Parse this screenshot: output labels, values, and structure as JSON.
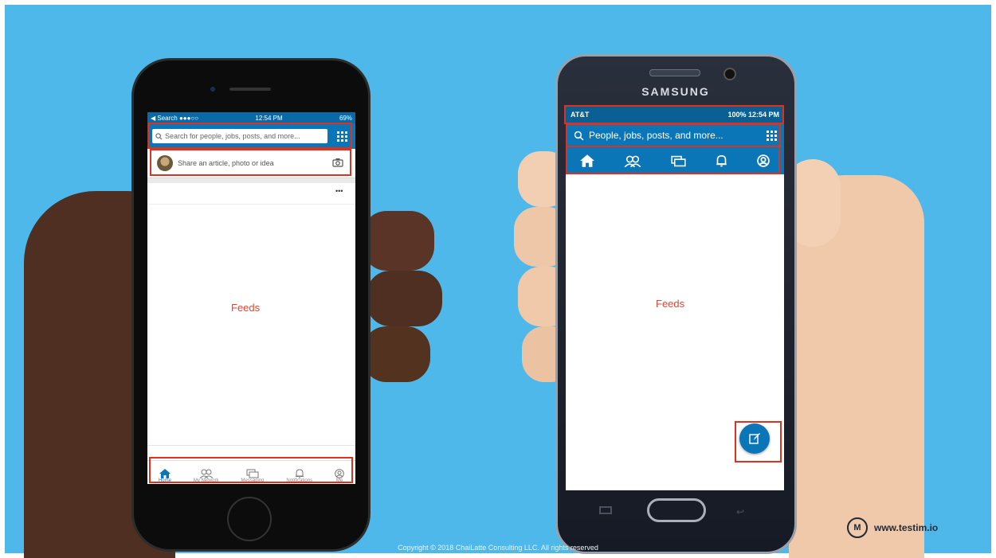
{
  "iphone": {
    "status": {
      "carrier": "◀ Search ●●●○○",
      "time": "12:54 PM",
      "battery": "69%"
    },
    "search_placeholder": "Search for people, jobs, posts, and more...",
    "share_placeholder": "Share an article, photo or idea",
    "more_label": "•••",
    "feeds_label": "Feeds",
    "tabs": [
      {
        "label": "Home",
        "icon": "home-icon"
      },
      {
        "label": "My Network",
        "icon": "people-icon"
      },
      {
        "label": "Messaging",
        "icon": "message-icon"
      },
      {
        "label": "Notifications",
        "icon": "bell-icon"
      },
      {
        "label": "Me",
        "icon": "profile-icon"
      }
    ]
  },
  "samsung": {
    "brand": "SAMSUNG",
    "status": {
      "left": "AT&T",
      "right": "100% 12:54 PM"
    },
    "search_placeholder": "People, jobs, posts, and more...",
    "feeds_label": "Feeds",
    "tabs": [
      "home-icon",
      "people-icon",
      "message-icon",
      "bell-icon",
      "profile-icon"
    ],
    "fab_icon": "compose-icon"
  },
  "footer": {
    "copyright": "Copyright © 2018 ChaiLatte Consulting LLC. All rights reserved",
    "brand_letter": "M",
    "brand_url": "www.testim.io"
  },
  "colors": {
    "background": "#4fb8ea",
    "linkedin_blue": "#0a76b7",
    "highlight": "#e0301e",
    "feeds": "#e8422e"
  }
}
